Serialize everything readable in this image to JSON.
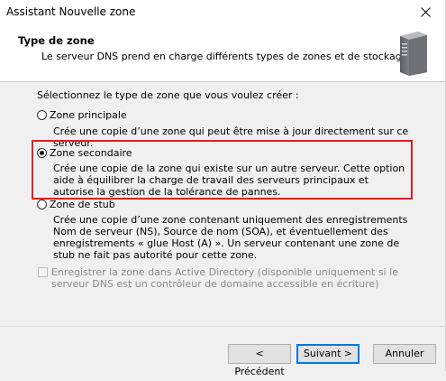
{
  "window": {
    "title": "Assistant Nouvelle zone"
  },
  "header": {
    "title": "Type de zone",
    "description": "Le serveur DNS prend en charge différents types de zones et de stockages."
  },
  "content": {
    "prompt": "Sélectionnez le type de zone que vous voulez créer :",
    "options": [
      {
        "label": "Zone principale",
        "checked": false,
        "description": "Crée une copie d’une zone qui peut être mise à jour directement sur ce serveur."
      },
      {
        "label": "Zone secondaire",
        "checked": true,
        "description": "Crée une copie de la zone qui existe sur un autre serveur. Cette option aide à équilibrer la charge de travail des serveurs principaux et autorise la gestion de la tolérance de pannes."
      },
      {
        "label": "Zone de stub",
        "checked": false,
        "description": "Crée une copie d’une zone contenant uniquement des enregistrements Nom de serveur (NS), Source de nom (SOA), et éventuellement des enregistrements « glue Host (A) ». Un serveur contenant une zone de stub ne fait pas autorité pour cette zone."
      }
    ],
    "ad_checkbox": {
      "label": "Enregistrer la zone dans Active Directory (disponible uniquement si le serveur DNS est un contrôleur de domaine accessible en écriture)",
      "checked": false,
      "disabled": true
    }
  },
  "buttons": {
    "back": "< Précédent",
    "next": "Suivant >",
    "cancel": "Annuler"
  },
  "colors": {
    "highlight": "#e02020",
    "primary_border": "#0078d7"
  }
}
